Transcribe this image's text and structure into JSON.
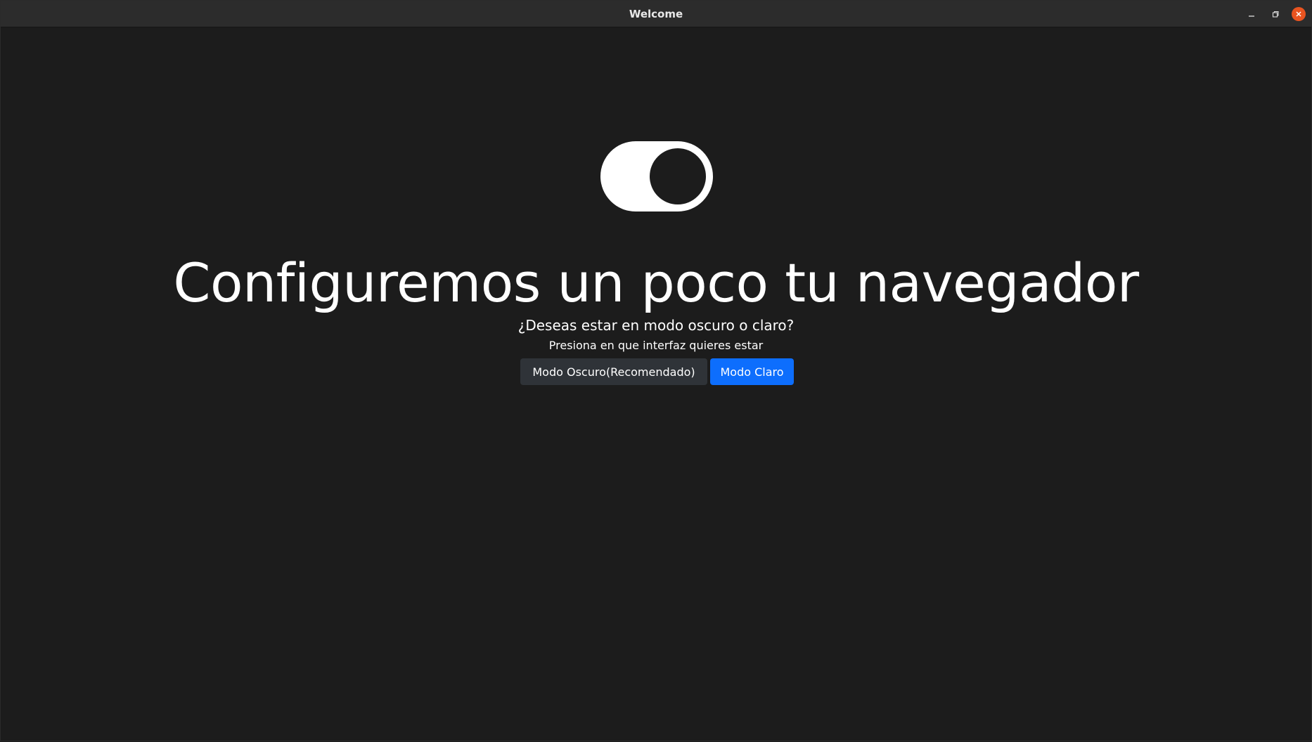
{
  "window": {
    "title": "Welcome"
  },
  "welcome": {
    "icon": "toggle-switch-icon",
    "headline": "Configuremos un poco tu navegador",
    "question": "¿Deseas estar en modo oscuro o claro?",
    "instruction": "Presiona en que interfaz quieres estar",
    "dark_button_label": "Modo Oscuro(Recomendado)",
    "light_button_label": "Modo Claro"
  },
  "colors": {
    "background": "#1c1c1c",
    "titlebar": "#2c2c2c",
    "dark_button": "#2f3338",
    "primary_button": "#0d6efd",
    "close_button": "#e95420"
  }
}
